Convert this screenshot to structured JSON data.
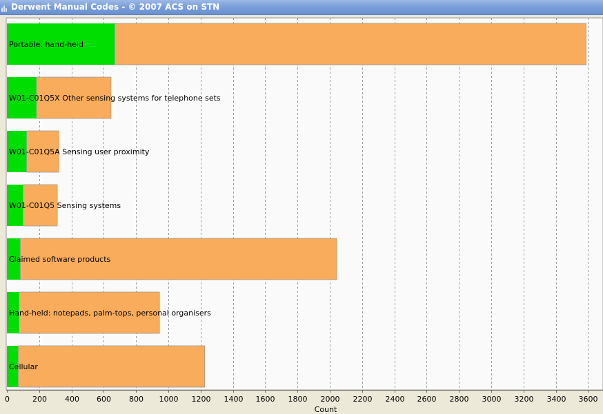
{
  "window": {
    "title": "Derwent Manual Codes - © 2007 ACS on STN",
    "icon": "bar-chart-icon"
  },
  "colors": {
    "primary_segment": "#00dd00",
    "secondary_segment": "#f9ac5b",
    "plot_background": "#fafafa",
    "gridline": "#9a9a9a"
  },
  "chart_data": {
    "type": "bar",
    "orientation": "horizontal",
    "stacked": true,
    "xlabel": "Count",
    "ylabel": "",
    "xlim": [
      0,
      3700
    ],
    "xticks": [
      0,
      200,
      400,
      600,
      800,
      1000,
      1200,
      1400,
      1600,
      1800,
      2000,
      2200,
      2400,
      2600,
      2800,
      3000,
      3200,
      3400,
      3600
    ],
    "grid": "vertical dashed",
    "categories": [
      "Portable: hand-held",
      "W01-C01Q5X Other sensing systems for telephone sets",
      "W01-C01Q5A Sensing user proximity",
      "W01-C01Q5 Sensing systems",
      "Claimed software products",
      "Hand-held: notepads, palm-tops, personal organisers",
      "Cellular"
    ],
    "series": [
      {
        "values": [
          668,
          183,
          122,
          100,
          83,
          75,
          70
        ]
      },
      {
        "values": [
          2920,
          462,
          200,
          212,
          1960,
          870,
          1155
        ]
      }
    ]
  }
}
